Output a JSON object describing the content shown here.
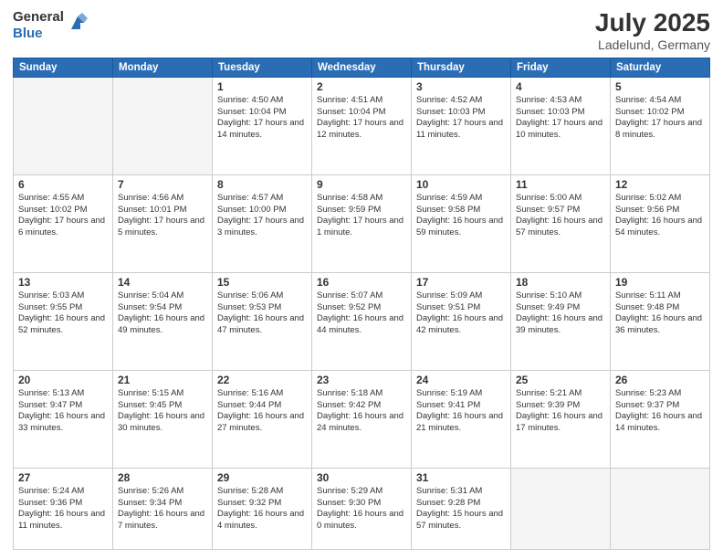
{
  "logo": {
    "general": "General",
    "blue": "Blue"
  },
  "header": {
    "month_year": "July 2025",
    "location": "Ladelund, Germany"
  },
  "weekdays": [
    "Sunday",
    "Monday",
    "Tuesday",
    "Wednesday",
    "Thursday",
    "Friday",
    "Saturday"
  ],
  "weeks": [
    [
      {
        "day": "",
        "info": ""
      },
      {
        "day": "",
        "info": ""
      },
      {
        "day": "1",
        "info": "Sunrise: 4:50 AM\nSunset: 10:04 PM\nDaylight: 17 hours\nand 14 minutes."
      },
      {
        "day": "2",
        "info": "Sunrise: 4:51 AM\nSunset: 10:04 PM\nDaylight: 17 hours\nand 12 minutes."
      },
      {
        "day": "3",
        "info": "Sunrise: 4:52 AM\nSunset: 10:03 PM\nDaylight: 17 hours\nand 11 minutes."
      },
      {
        "day": "4",
        "info": "Sunrise: 4:53 AM\nSunset: 10:03 PM\nDaylight: 17 hours\nand 10 minutes."
      },
      {
        "day": "5",
        "info": "Sunrise: 4:54 AM\nSunset: 10:02 PM\nDaylight: 17 hours\nand 8 minutes."
      }
    ],
    [
      {
        "day": "6",
        "info": "Sunrise: 4:55 AM\nSunset: 10:02 PM\nDaylight: 17 hours\nand 6 minutes."
      },
      {
        "day": "7",
        "info": "Sunrise: 4:56 AM\nSunset: 10:01 PM\nDaylight: 17 hours\nand 5 minutes."
      },
      {
        "day": "8",
        "info": "Sunrise: 4:57 AM\nSunset: 10:00 PM\nDaylight: 17 hours\nand 3 minutes."
      },
      {
        "day": "9",
        "info": "Sunrise: 4:58 AM\nSunset: 9:59 PM\nDaylight: 17 hours\nand 1 minute."
      },
      {
        "day": "10",
        "info": "Sunrise: 4:59 AM\nSunset: 9:58 PM\nDaylight: 16 hours\nand 59 minutes."
      },
      {
        "day": "11",
        "info": "Sunrise: 5:00 AM\nSunset: 9:57 PM\nDaylight: 16 hours\nand 57 minutes."
      },
      {
        "day": "12",
        "info": "Sunrise: 5:02 AM\nSunset: 9:56 PM\nDaylight: 16 hours\nand 54 minutes."
      }
    ],
    [
      {
        "day": "13",
        "info": "Sunrise: 5:03 AM\nSunset: 9:55 PM\nDaylight: 16 hours\nand 52 minutes."
      },
      {
        "day": "14",
        "info": "Sunrise: 5:04 AM\nSunset: 9:54 PM\nDaylight: 16 hours\nand 49 minutes."
      },
      {
        "day": "15",
        "info": "Sunrise: 5:06 AM\nSunset: 9:53 PM\nDaylight: 16 hours\nand 47 minutes."
      },
      {
        "day": "16",
        "info": "Sunrise: 5:07 AM\nSunset: 9:52 PM\nDaylight: 16 hours\nand 44 minutes."
      },
      {
        "day": "17",
        "info": "Sunrise: 5:09 AM\nSunset: 9:51 PM\nDaylight: 16 hours\nand 42 minutes."
      },
      {
        "day": "18",
        "info": "Sunrise: 5:10 AM\nSunset: 9:49 PM\nDaylight: 16 hours\nand 39 minutes."
      },
      {
        "day": "19",
        "info": "Sunrise: 5:11 AM\nSunset: 9:48 PM\nDaylight: 16 hours\nand 36 minutes."
      }
    ],
    [
      {
        "day": "20",
        "info": "Sunrise: 5:13 AM\nSunset: 9:47 PM\nDaylight: 16 hours\nand 33 minutes."
      },
      {
        "day": "21",
        "info": "Sunrise: 5:15 AM\nSunset: 9:45 PM\nDaylight: 16 hours\nand 30 minutes."
      },
      {
        "day": "22",
        "info": "Sunrise: 5:16 AM\nSunset: 9:44 PM\nDaylight: 16 hours\nand 27 minutes."
      },
      {
        "day": "23",
        "info": "Sunrise: 5:18 AM\nSunset: 9:42 PM\nDaylight: 16 hours\nand 24 minutes."
      },
      {
        "day": "24",
        "info": "Sunrise: 5:19 AM\nSunset: 9:41 PM\nDaylight: 16 hours\nand 21 minutes."
      },
      {
        "day": "25",
        "info": "Sunrise: 5:21 AM\nSunset: 9:39 PM\nDaylight: 16 hours\nand 17 minutes."
      },
      {
        "day": "26",
        "info": "Sunrise: 5:23 AM\nSunset: 9:37 PM\nDaylight: 16 hours\nand 14 minutes."
      }
    ],
    [
      {
        "day": "27",
        "info": "Sunrise: 5:24 AM\nSunset: 9:36 PM\nDaylight: 16 hours\nand 11 minutes."
      },
      {
        "day": "28",
        "info": "Sunrise: 5:26 AM\nSunset: 9:34 PM\nDaylight: 16 hours\nand 7 minutes."
      },
      {
        "day": "29",
        "info": "Sunrise: 5:28 AM\nSunset: 9:32 PM\nDaylight: 16 hours\nand 4 minutes."
      },
      {
        "day": "30",
        "info": "Sunrise: 5:29 AM\nSunset: 9:30 PM\nDaylight: 16 hours\nand 0 minutes."
      },
      {
        "day": "31",
        "info": "Sunrise: 5:31 AM\nSunset: 9:28 PM\nDaylight: 15 hours\nand 57 minutes."
      },
      {
        "day": "",
        "info": ""
      },
      {
        "day": "",
        "info": ""
      }
    ]
  ]
}
